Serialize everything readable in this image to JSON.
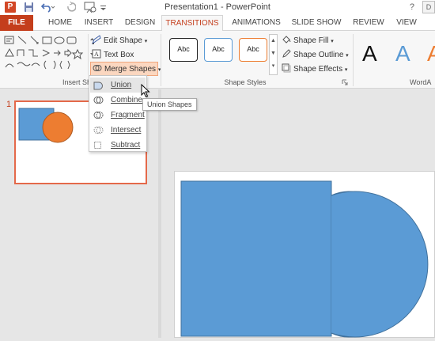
{
  "window": {
    "title": "Presentation1 - PowerPoint",
    "app_badge": "P",
    "help": "?",
    "corner": "D"
  },
  "qat": {
    "save_icon": "save-icon",
    "undo_icon": "undo-icon",
    "redo_icon": "redo-icon",
    "slideshow_icon": "start-slideshow-icon",
    "customize_icon": "customize-qat-icon"
  },
  "tabs": [
    {
      "label": "FILE"
    },
    {
      "label": "HOME"
    },
    {
      "label": "INSERT"
    },
    {
      "label": "DESIGN"
    },
    {
      "label": "TRANSITIONS"
    },
    {
      "label": "ANIMATIONS"
    },
    {
      "label": "SLIDE SHOW"
    },
    {
      "label": "REVIEW"
    },
    {
      "label": "VIEW"
    }
  ],
  "ribbon": {
    "insert_shapes": {
      "label": "Insert Sha",
      "edit_shape": "Edit Shape",
      "text_box": "Text Box",
      "merge_shapes": "Merge Shapes"
    },
    "shape_styles": {
      "label": "Shape Styles",
      "thumbs": [
        "Abc",
        "Abc",
        "Abc"
      ],
      "thumb_colors": [
        "#222222",
        "#5b9bd5",
        "#ed7d31"
      ],
      "shape_fill": "Shape Fill",
      "shape_outline": "Shape Outline",
      "shape_effects": "Shape Effects"
    },
    "wordart": {
      "label": "WordA",
      "samples": [
        "A",
        "A",
        "A"
      ],
      "colors": [
        "#111111",
        "#5b9bd5",
        "#ed7d31"
      ]
    }
  },
  "merge_menu": {
    "items": [
      {
        "label": "Union",
        "icon": "union-icon"
      },
      {
        "label": "Combine",
        "icon": "combine-icon"
      },
      {
        "label": "Fragment",
        "icon": "fragment-icon"
      },
      {
        "label": "Intersect",
        "icon": "intersect-icon"
      },
      {
        "label": "Subtract",
        "icon": "subtract-icon"
      }
    ],
    "tooltip": "Union Shapes"
  },
  "slides_pane": {
    "slide_number": "1"
  },
  "colors": {
    "accent": "#c43e1c",
    "shape_blue": "#5b9bd5",
    "shape_orange": "#ed7d31"
  }
}
